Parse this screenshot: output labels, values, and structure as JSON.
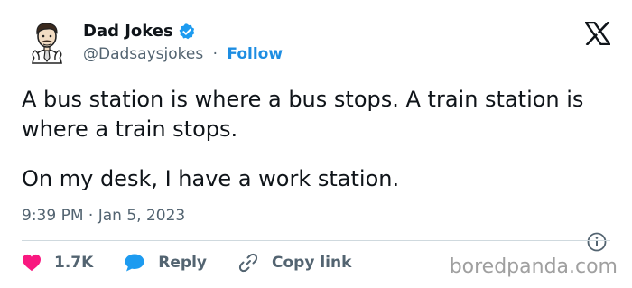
{
  "author": {
    "display_name": "Dad Jokes",
    "handle": "@Dadsaysjokes",
    "separator": "·",
    "follow_label": "Follow",
    "avatar_icon": "cartoon-dad-avatar",
    "verified_icon": "verified-badge-icon"
  },
  "tweet": {
    "line1": "A bus station is where a bus stops. A train station is where a train stops.",
    "line2": "On my desk, I have a work station."
  },
  "meta": {
    "timestamp": "9:39 PM · Jan 5, 2023"
  },
  "actions": {
    "like_count": "1.7K",
    "reply_label": "Reply",
    "copy_link_label": "Copy link"
  },
  "watermark": "boredpanda.com",
  "colors": {
    "text": "#0f1419",
    "secondary": "#536471",
    "accent": "#1d8de2",
    "like": "#f91880",
    "divider": "#cfd9de"
  }
}
